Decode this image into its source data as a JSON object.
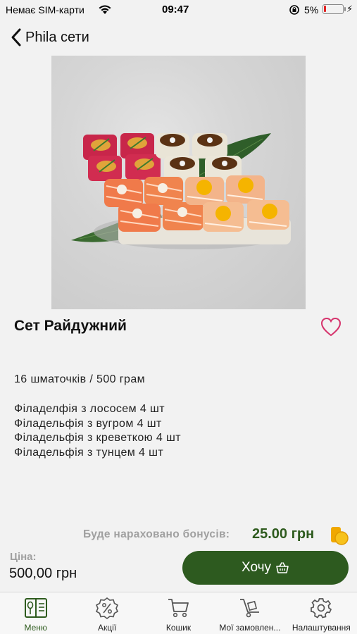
{
  "status_bar": {
    "carrier": "Немає SIM-карти",
    "time": "09:47",
    "battery": "5%"
  },
  "header": {
    "back_label": "Phila сети"
  },
  "product": {
    "title": "Сет Райдужний",
    "weight": "16 шматочків / 500 грам",
    "composition": [
      "Філаделфія з лососем 4 шт",
      "Філадельфія з вугром 4 шт",
      "Філадельфія з креветкою 4 шт",
      "Філадельфія з тунцем 4 шт"
    ]
  },
  "bonus": {
    "label": "Буде нараховано бонусів:",
    "value": "25.00 грн"
  },
  "price": {
    "label": "Ціна:",
    "value": "500,00 грн"
  },
  "cta": {
    "label": "Хочу"
  },
  "tabs": [
    {
      "label": "Меню",
      "icon": "menu-book-icon",
      "active": true
    },
    {
      "label": "Акції",
      "icon": "discount-icon",
      "active": false
    },
    {
      "label": "Кошик",
      "icon": "cart-icon",
      "active": false
    },
    {
      "label": "Мої замовлен...",
      "icon": "orders-icon",
      "active": false
    },
    {
      "label": "Налаштування",
      "icon": "gear-icon",
      "active": false
    }
  ],
  "colors": {
    "accent": "#2d5a1f",
    "heart": "#d6336c",
    "muted": "#a0a0a0"
  }
}
